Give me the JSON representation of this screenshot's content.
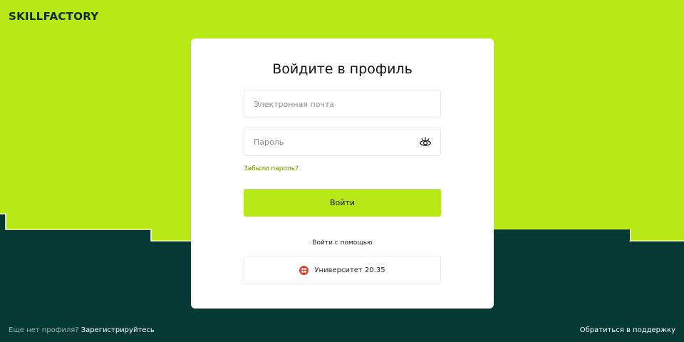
{
  "brand": {
    "logo_text": "SKILLFACTORY"
  },
  "colors": {
    "accent": "#b7e916",
    "dark": "#043a33",
    "link_green": "#6b9200"
  },
  "login": {
    "title": "Войдите в профиль",
    "email_placeholder": "Электронная почта",
    "password_placeholder": "Пароль",
    "forgot_link": "Забыли пароль?",
    "submit_label": "Войти",
    "alt_login_label": "Войти с помощью",
    "university_button_label": "Университет 20.35"
  },
  "footer": {
    "no_profile_text": "Еще нет профиля?",
    "register_link": "Зарегистрируйтесь",
    "support_link": "Обратиться в поддержку"
  },
  "icons": {
    "password_toggle": "eye-icon",
    "university": "university-2035-icon"
  }
}
